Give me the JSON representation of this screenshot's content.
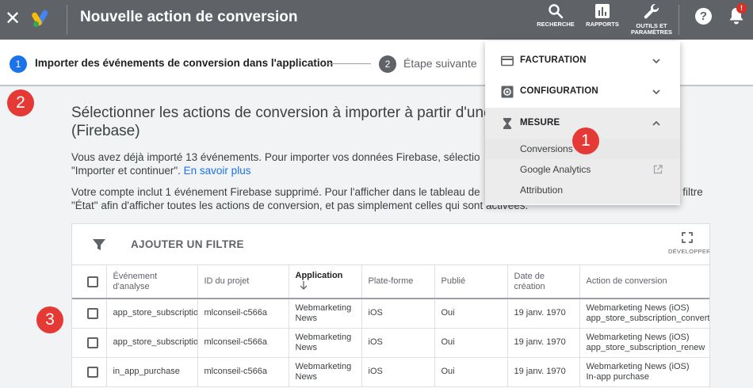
{
  "topbar": {
    "title": "Nouvelle action de conversion",
    "search_label": "RECHERCHE",
    "reports_label": "RAPPORTS",
    "tools_label_line1": "OUTILS ET",
    "tools_label_line2": "PARAMÈTRES",
    "help_glyph": "?",
    "bell_badge": "!",
    "close_glyph": "✕"
  },
  "stepper": {
    "step1_number": "1",
    "step1_label": "Importer des événements de conversion dans l'application",
    "step2_number": "2",
    "step2_label": "Étape suivante"
  },
  "markers": {
    "m1": "1",
    "m2": "2",
    "m3": "3"
  },
  "main": {
    "heading_line1": "Sélectionner les actions de conversion à importer à partir d'une p",
    "heading_line2": "(Firebase)",
    "para1_line1": "Vous avez déjà importé 13 événements. Pour importer vos données Firebase, sélectio",
    "para1_line2_start": "\"Importer et continuer\". ",
    "para1_link": "En savoir plus",
    "para2_line1": "Votre compte inclut 1 événement Firebase supprimé. Pour l'afficher dans le tableau de",
    "para2_line1_end": "e filtre",
    "para2_line2": "\"État\" afin d'afficher toutes les actions de conversion, et pas simplement celles qui sont activées."
  },
  "table": {
    "add_filter_label": "AJOUTER UN FILTRE",
    "expand_label": "DÉVELOPPER",
    "headers": {
      "event": "Événement d'analyse",
      "project": "ID du projet",
      "app": "Application",
      "platform": "Plate-forme",
      "published": "Publié",
      "date": "Date de création",
      "action": "Action de conversion"
    },
    "rows": [
      {
        "event": "app_store_subscriptio",
        "project": "mlconseil-c566a",
        "app": "Webmarketing News",
        "platform": "iOS",
        "published": "Oui",
        "date": "19 janv. 1970",
        "action_line1": "Webmarketing News (iOS)",
        "action_line2": "app_store_subscription_convert"
      },
      {
        "event": "app_store_subscriptio",
        "project": "mlconseil-c566a",
        "app": "Webmarketing News",
        "platform": "iOS",
        "published": "Oui",
        "date": "19 janv. 1970",
        "action_line1": "Webmarketing News (iOS)",
        "action_line2": "app_store_subscription_renew"
      },
      {
        "event": "in_app_purchase",
        "project": "mlconseil-c566a",
        "app": "Webmarketing News",
        "platform": "iOS",
        "published": "Oui",
        "date": "19 janv. 1970",
        "action_line1": "Webmarketing News (iOS)",
        "action_line2": "In-app purchase"
      }
    ]
  },
  "menu": {
    "billing": "FACTURATION",
    "setup": "CONFIGURATION",
    "measure": "MESURE",
    "items": [
      "Conversions",
      "Google Analytics",
      "Attribution"
    ]
  },
  "colors": {
    "topbar": "#5f6368",
    "accent": "#1a73e8",
    "marker": "#e53935",
    "badge": "#d93025"
  }
}
